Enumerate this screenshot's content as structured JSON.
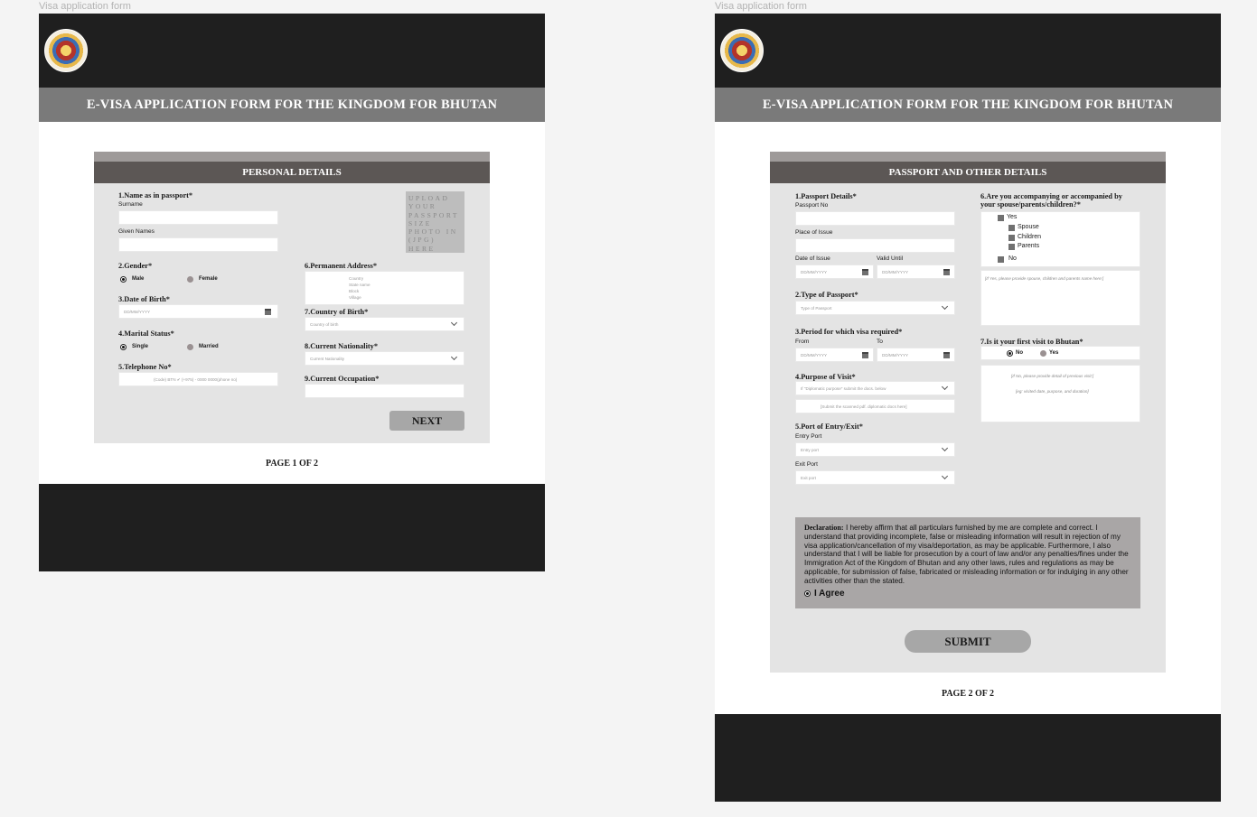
{
  "frames": [
    {
      "label": "Visa application form"
    },
    {
      "label": "Visa application form"
    }
  ],
  "header": {
    "title": "E-VISA APPLICATION FORM FOR THE KINGDOM FOR BHUTAN"
  },
  "page1": {
    "section_title": "PERSONAL DETAILS",
    "q1": {
      "label": "1.Name as in passport*",
      "surname": "Surname",
      "given": "Given Names"
    },
    "photo_upload": "UPLOAD YOUR PASSPORT SIZE PHOTO IN (JPG) HERE",
    "q2": {
      "label": "2.Gender*",
      "male": "Male",
      "female": "Female"
    },
    "q3": {
      "label": "3.Date of Birth*",
      "placeholder": "DD/MM/YYYY"
    },
    "q4": {
      "label": "4.Marital Status*",
      "single": "Single",
      "married": "Married"
    },
    "q5": {
      "label": "5.Telephone No*",
      "placeholder": "(Code) BTN ✔ (+975) - 0000 0000(phone no)"
    },
    "q6": {
      "label": "6.Permanent Address*",
      "lines": [
        "Country",
        "State name",
        "Block",
        "Village"
      ]
    },
    "q7": {
      "label": "7.Country of Birth*",
      "placeholder": "Country of birth"
    },
    "q8": {
      "label": "8.Current Nationality*",
      "placeholder": "Current Nationality"
    },
    "q9": {
      "label": "9.Current Occupation*"
    },
    "next": "NEXT",
    "page_num": "PAGE 1 OF 2"
  },
  "page2": {
    "section_title": "PASSPORT AND OTHER DETAILS",
    "q1": {
      "label": "1.Passport Details*",
      "passport_no": "Passport No",
      "place": "Place of Issue",
      "issue": "Date of Issue",
      "valid": "Valid Until",
      "placeholder": "DD/MM/YYYY"
    },
    "q2": {
      "label": "2.Type of Passport*",
      "placeholder": "Type of Passport"
    },
    "q3": {
      "label": "3.Period for which visa required*",
      "from": "From",
      "to": "To",
      "placeholder": "DD/MM/YYYY"
    },
    "q4": {
      "label": "4.Purpose of Visit*",
      "placeholder": "If \"Diplomatic purpose\" submit the docs. below",
      "upload": "[Submit the scanned pdf. diplomatic docs here]"
    },
    "q5": {
      "label": "5.Port of Entry/Exit*",
      "entry": "Entry Port",
      "entry_ph": "Entry port",
      "exit": "Exit Port",
      "exit_ph": "Exit port"
    },
    "q6": {
      "label_line1": "6.Are you accompanying or accompanied by",
      "label_line2": "your spouse/parents/children?*",
      "yes": "Yes",
      "spouse": "Spouse",
      "children": "Children",
      "parents": "Parents",
      "no": "No",
      "hint": "[If Yes, please provide spouse, children and parents name here:]"
    },
    "q7": {
      "label": "7.Is it your first visit to Bhutan*",
      "no": "No",
      "yes": "Yes",
      "hint1": "[If No, please provide detail of previous visit:]",
      "hint2": "[eg: visited date, purpose, and duration]"
    },
    "declaration": {
      "heading": "Declaration:",
      "text": "I hereby affirm that all particulars furnished by me are complete and correct. I understand that providing incomplete, false or misleading information will result in rejection of my visa application/cancellation of my visa/deportation, as may be applicable. Furthermore, I also understand that I will be liable for prosecution by a court of law and/or any penalties/fines under the Immigration Act of the Kingdom of Bhutan and any other laws, rules and regulations as may be applicable, for submission of false, fabricated or misleading information or for indulging in any other activities other than the stated.",
      "agree": "I Agree"
    },
    "submit": "SUBMIT",
    "page_num": "PAGE 2 OF 2"
  }
}
